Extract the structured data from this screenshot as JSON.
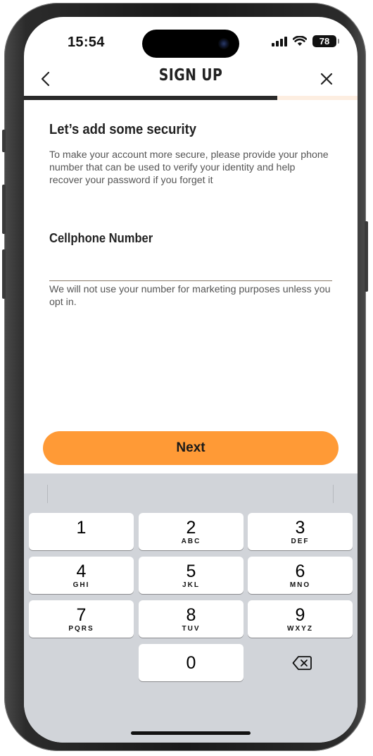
{
  "status_bar": {
    "time": "15:54",
    "battery": "78"
  },
  "nav": {
    "title": "SIGN UP",
    "back_icon": "chevron-left-icon",
    "close_icon": "close-icon"
  },
  "progress": {
    "fraction": 0.76,
    "fill_color": "#2a2a2a",
    "track_color": "#fdeee1"
  },
  "content": {
    "heading": "Let’s add some security",
    "description": "To make your account more secure, please provide your phone number that can be used to verify your identity and help recover your password if you forget it",
    "field_label": "Cellphone Number",
    "phone_value": "",
    "hint": "We will not use your number for marketing purposes unless you opt in."
  },
  "next_button": {
    "label": "Next",
    "color": "#ff9a36"
  },
  "keypad": {
    "keys": [
      {
        "digit": "1",
        "letters": ""
      },
      {
        "digit": "2",
        "letters": "ABC"
      },
      {
        "digit": "3",
        "letters": "DEF"
      },
      {
        "digit": "4",
        "letters": "GHI"
      },
      {
        "digit": "5",
        "letters": "JKL"
      },
      {
        "digit": "6",
        "letters": "MNO"
      },
      {
        "digit": "7",
        "letters": "PQRS"
      },
      {
        "digit": "8",
        "letters": "TUV"
      },
      {
        "digit": "9",
        "letters": "WXYZ"
      },
      {
        "digit": "0",
        "letters": ""
      }
    ],
    "delete_icon": "backspace-icon"
  }
}
